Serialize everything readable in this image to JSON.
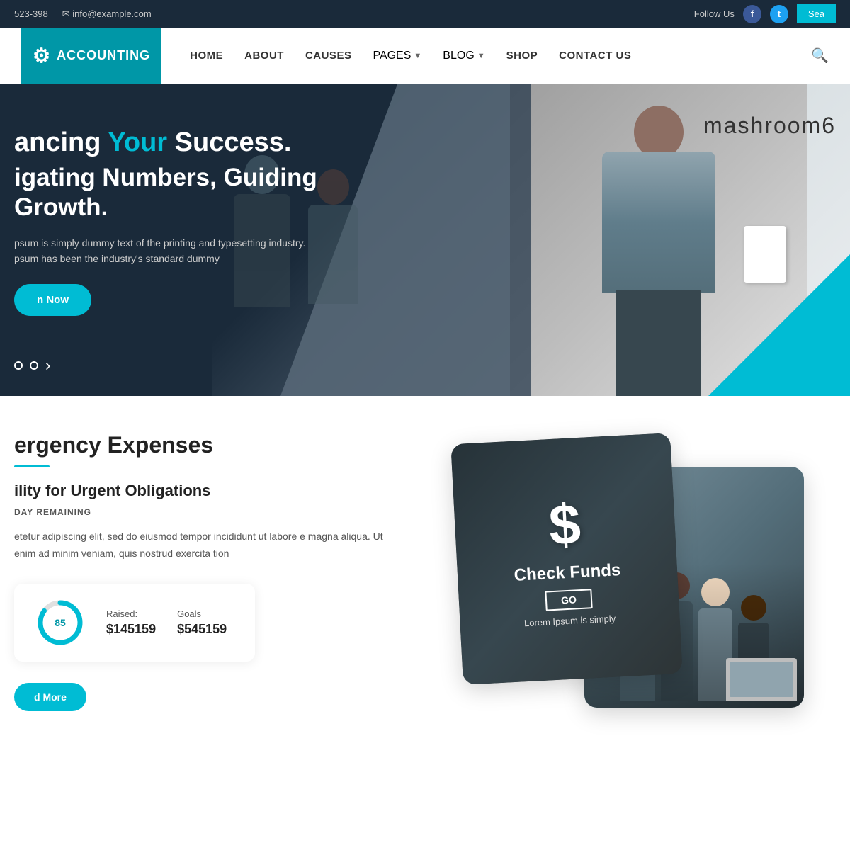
{
  "topbar": {
    "phone": "523-398",
    "email": "info@example.com",
    "follow_label": "Follow Us",
    "search_label": "Sea"
  },
  "header": {
    "logo_text": "ACCOUNTING",
    "nav": [
      {
        "label": "HOME",
        "id": "home",
        "dropdown": false
      },
      {
        "label": "ABOUT",
        "id": "about",
        "dropdown": false
      },
      {
        "label": "CAUSES",
        "id": "causes",
        "dropdown": false
      },
      {
        "label": "PAGES",
        "id": "pages",
        "dropdown": true
      },
      {
        "label": "BLOG",
        "id": "blog",
        "dropdown": true
      },
      {
        "label": "SHOP",
        "id": "shop",
        "dropdown": false
      },
      {
        "label": "CONTACT US",
        "id": "contact",
        "dropdown": false
      }
    ]
  },
  "hero": {
    "title_line1_prefix": "ancing ",
    "title_line1_highlight": "Your",
    "title_line1_suffix": " Success.",
    "title_line2_prefix": "igating Numbers, ",
    "title_line2_suffix": "Guiding Growth.",
    "desc_line1": "psum is simply dummy text of the printing and typesetting industry.",
    "desc_line2": "psum has been the industry's standard dummy",
    "btn_label": "n Now",
    "mashroom_text": "mashroom6",
    "dots": [
      "dot1",
      "dot2"
    ],
    "arrow": "›"
  },
  "section": {
    "title": "ergency Expenses",
    "subtitle": "ility for Urgent Obligations",
    "tag": "DAY REMAINING",
    "desc": "etetur adipiscing elit, sed do eiusmod tempor incididunt ut labore\ne magna aliqua. Ut enim ad minim veniam, quis nostrud exercita tion",
    "progress_percent": 85,
    "raised_label": "Raised:",
    "raised_value": "$145159",
    "goals_label": "Goals",
    "goals_value": "$545159",
    "read_more_label": "d More"
  },
  "cards": {
    "card1": {
      "dollar": "$",
      "title": "Check Funds",
      "go_label": "GO",
      "caption": "Lorem Ipsum is simply"
    },
    "card2": {
      "alt": "Team meeting photo"
    }
  },
  "colors": {
    "primary": "#00bcd4",
    "dark": "#1a2a3a",
    "accent": "#0097a7"
  }
}
